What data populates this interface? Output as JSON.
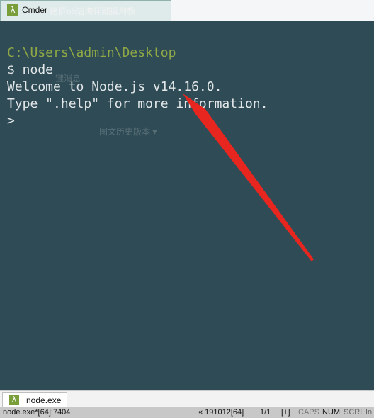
{
  "window": {
    "title": "Cmder",
    "icon": "lambda-icon",
    "overlay_text": "建群ob洁海详细操用教"
  },
  "terminal": {
    "background": "#2f4c56",
    "path_color": "#8fa845",
    "lines": {
      "path": "C:\\Users\\admin\\Desktop",
      "command": "$ node",
      "welcome": "Welcome to Node.js v14.16.0.",
      "help": "Type \".help\" for more information.",
      "prompt": ">"
    },
    "ghost_texts": [
      "键消息",
      "图文历史版本 ▾"
    ],
    "annotation": {
      "type": "red-arrow",
      "color": "#e6261f"
    }
  },
  "tabs": [
    {
      "label": "node.exe",
      "icon": "lambda-icon"
    }
  ],
  "status_bar": {
    "process": "node.exe*[64]:7404",
    "position": "« 191012[64]",
    "page": "1/1",
    "plus": "[+]",
    "caps": "CAPS",
    "num": "NUM",
    "scrl": "SCRL",
    "ins": "In"
  }
}
